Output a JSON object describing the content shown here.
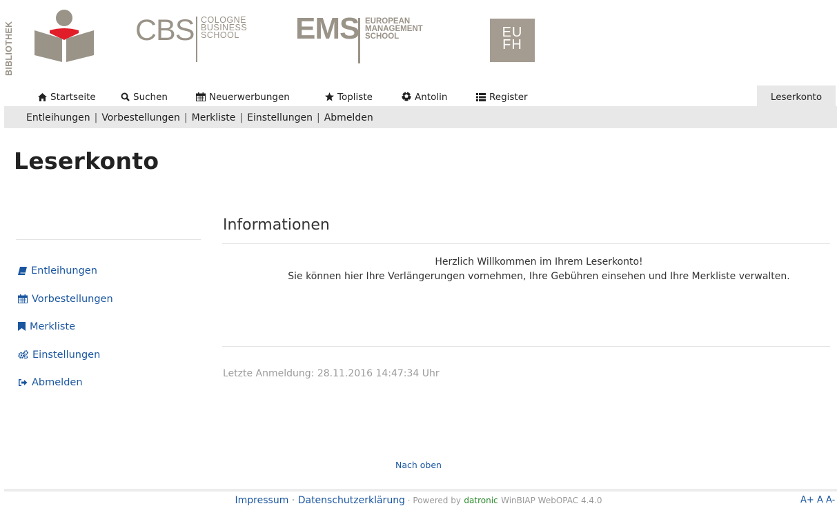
{
  "header": {
    "bibliothek_label": "BIBLIOTHEK",
    "cbs": {
      "name": "CBS",
      "subtitle": "COLOGNE\nBUSINESS\nSCHOOL"
    },
    "ems": {
      "name": "EMS",
      "subtitle": "EUROPEAN\nMANAGEMENT\nSCHOOL"
    },
    "eufh": {
      "line1": "EU",
      "line2": "FH"
    },
    "brand_color": "#9a9388",
    "reader_logo_accent": "#e11d2a"
  },
  "topnav": {
    "items": [
      {
        "label": "Startseite",
        "icon": "home-icon"
      },
      {
        "label": "Suchen",
        "icon": "search-icon"
      },
      {
        "label": "Neuerwerbungen",
        "icon": "calendar-icon"
      },
      {
        "label": "Topliste",
        "icon": "star-icon"
      },
      {
        "label": "Antolin",
        "icon": "soccer-ball-icon"
      },
      {
        "label": "Register",
        "icon": "list-icon"
      }
    ],
    "active_tab": "Leserkonto"
  },
  "subnav": {
    "items": [
      "Entleihungen",
      "Vorbestellungen",
      "Merkliste",
      "Einstellungen",
      "Abmelden"
    ]
  },
  "page": {
    "title": "Leserkonto"
  },
  "sidebar": {
    "items": [
      {
        "label": "Entleihungen",
        "icon": "book-icon"
      },
      {
        "label": "Vorbestellungen",
        "icon": "calendar-icon"
      },
      {
        "label": "Merkliste",
        "icon": "bookmark-icon"
      },
      {
        "label": "Einstellungen",
        "icon": "cogs-icon"
      },
      {
        "label": "Abmelden",
        "icon": "sign-out-icon"
      }
    ]
  },
  "main": {
    "section_title": "Informationen",
    "welcome_line1": "Herzlich Willkommen im Ihrem Leserkonto!",
    "welcome_line2": "Sie können hier Ihre Verlängerungen vornehmen, Ihre Gebühren einsehen und Ihre Merkliste verwalten.",
    "last_login": "Letzte Anmeldung: 28.11.2016 14:47:34 Uhr"
  },
  "footer": {
    "to_top": "Nach oben",
    "impressum": "Impressum",
    "datenschutz": "Datenschutzerklärung",
    "separator": " · ",
    "powered_by": "Powered by",
    "vendor": "datronic",
    "product": "WinBIAP WebOPAC 4.4.0",
    "font_larger": "A+",
    "font_normal": "A",
    "font_smaller": "A-"
  },
  "colors": {
    "link": "#1a56a0",
    "nav_bar": "#e8e8e8",
    "muted_text": "#9b9b9b"
  }
}
